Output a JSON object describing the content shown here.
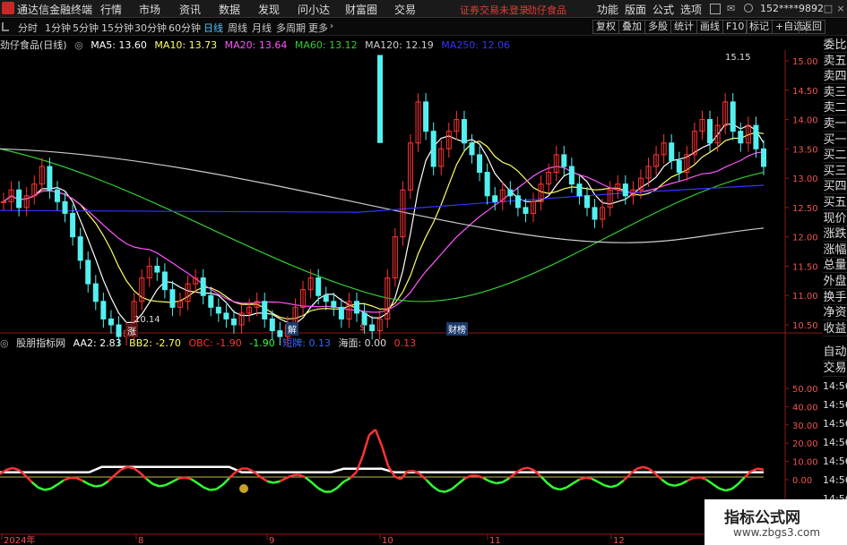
{
  "app": {
    "title": "通达信金融终端"
  },
  "menu": [
    "行情",
    "市场",
    "资讯",
    "数据",
    "发现",
    "问小达",
    "财富圈",
    "交易"
  ],
  "warnings": [
    "证券交易未登录",
    "劲仔食品"
  ],
  "right_menu": [
    "功能",
    "版面",
    "公式",
    "选项"
  ],
  "account": "152****9892",
  "window_buttons": [
    "-",
    "□",
    "×"
  ],
  "periods": [
    "分时",
    "1分钟",
    "5分钟",
    "15分钟",
    "30分钟",
    "60分钟",
    "日线",
    "周线",
    "月线",
    "多周期",
    "更多"
  ],
  "active_period": "日线",
  "tools": [
    "复权",
    "叠加",
    "多股",
    "统计",
    "画线",
    "F10",
    "标记",
    "+自选",
    "返回"
  ],
  "stock_title": "劲仔食品(日线)",
  "ma": {
    "ma5": "MA5: 13.60",
    "ma10": "MA10: 13.73",
    "ma20": "MA20: 13.64",
    "ma60": "MA60: 13.12",
    "ma120": "MA120: 12.19",
    "ma250": "MA250: 12.06"
  },
  "indicator": {
    "name": "股朋指标网",
    "aa2": "AA2: 2.83",
    "bb2": "BB2: -2.70",
    "obc": "OBC: -1.90",
    "obc_val": "-1.90",
    "lh": "短牌: 0.13",
    "sea": "海面: 0.00",
    "sea_val": "0.13"
  },
  "sidebar": [
    "委比",
    "卖五",
    "卖四",
    "卖三",
    "卖二",
    "卖一",
    "买一",
    "买二",
    "买三",
    "买四",
    "买五",
    "现价",
    "涨跌",
    "涨幅",
    "总量",
    "外盘",
    "换手",
    "净资",
    "收益"
  ],
  "sidebar2": [
    "自动",
    "交易"
  ],
  "times": [
    "14:56",
    "14:56",
    "14:56",
    "14:56",
    "14:56",
    "14:56",
    "14:56",
    "14:56",
    "14:56"
  ],
  "price_axis": [
    "15.00",
    "14.50",
    "14.00",
    "13.50",
    "13.00",
    "12.50",
    "12.00",
    "11.50",
    "11.00",
    "10.50"
  ],
  "ind_axis": [
    "50.00",
    "40.00",
    "30.00",
    "20.00",
    "10.00",
    "0.00"
  ],
  "date_axis": [
    "2024年",
    "8",
    "9",
    "10",
    "11",
    "12"
  ],
  "annotations": {
    "high": "15.15",
    "low": "10.14",
    "tags": [
      "涨",
      "解",
      "$",
      "财榜"
    ]
  },
  "watermark": {
    "title": "指标公式网",
    "url": "www.zbgs3.com"
  },
  "colors": {
    "up": "#ff3333",
    "down": "#54f0f0",
    "ma5": "#ffffff",
    "ma10": "#ffff66",
    "ma20": "#ff55ff",
    "ma60": "#33cc33",
    "ma120": "#cccccc",
    "ma250": "#3333ff"
  }
}
